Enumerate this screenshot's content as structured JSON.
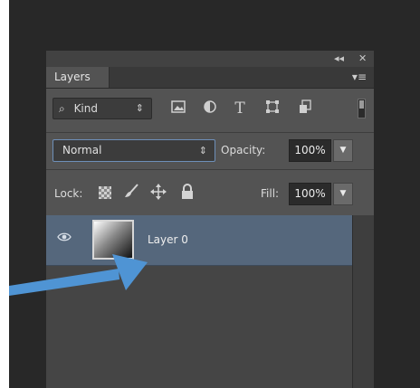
{
  "panel": {
    "collapse_glyph": "◂◂",
    "close_glyph": "✕",
    "tab_label": "Layers",
    "menu_glyph": "▾≡"
  },
  "filter": {
    "search_glyph": "⌕",
    "kind_label": "Kind",
    "spinner_glyph": "⇕",
    "icons": [
      "image-filter-icon",
      "adjustment-filter-icon",
      "type-filter-icon",
      "shape-filter-icon",
      "smart-object-filter-icon"
    ],
    "type_glyph": "T"
  },
  "blend": {
    "mode": "Normal",
    "spinner_glyph": "⇕",
    "opacity_label": "Opacity:",
    "opacity_value": "100%",
    "dropdown_glyph": "▼"
  },
  "lock": {
    "label": "Lock:",
    "icons": [
      "lock-transparent-pixels-icon",
      "lock-image-pixels-icon",
      "lock-position-icon",
      "lock-all-icon"
    ],
    "fill_label": "Fill:",
    "fill_value": "100%",
    "dropdown_glyph": "▼"
  },
  "layers": [
    {
      "name": "Layer 0",
      "visible": true,
      "selected": true
    }
  ],
  "colors": {
    "panel_bg": "#535353",
    "selected_row": "#55677c",
    "annotation_arrow": "#4f94d4"
  }
}
